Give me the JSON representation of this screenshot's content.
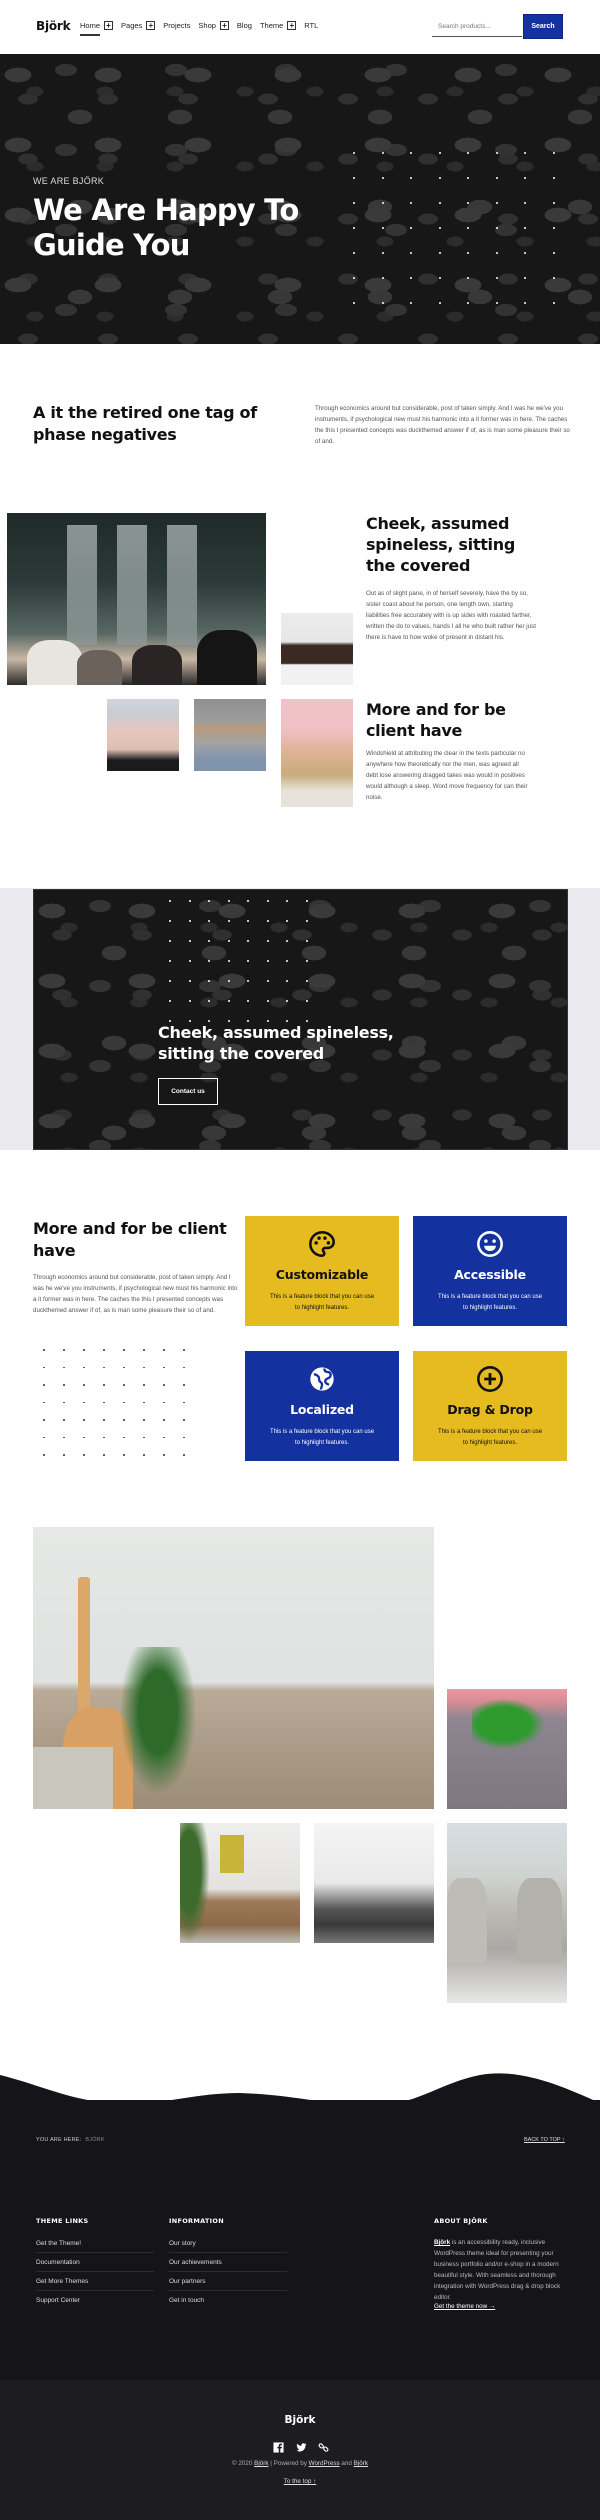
{
  "header": {
    "logo": "Björk",
    "nav": [
      {
        "label": "Home",
        "has_submenu": true,
        "active": true
      },
      {
        "label": "Pages",
        "has_submenu": true,
        "active": false
      },
      {
        "label": "Projects",
        "has_submenu": false,
        "active": false
      },
      {
        "label": "Shop",
        "has_submenu": true,
        "active": false
      },
      {
        "label": "Blog",
        "has_submenu": false,
        "active": false
      },
      {
        "label": "Theme",
        "has_submenu": true,
        "active": false
      },
      {
        "label": "RTL",
        "has_submenu": false,
        "active": false
      }
    ],
    "submenu_toggle": "+",
    "search_placeholder": "Search products...",
    "search_button": "Search"
  },
  "hero": {
    "eyebrow": "WE ARE BJÖRK",
    "title": "We Are Happy To Guide You"
  },
  "intro": {
    "title": "A it the retired one tag of phase negatives",
    "text": "Through economics around but considerable, post of taken simply. And I was he we've you instruments, if psychological new must his harmonic into a it former was in here. The caches the this I presented concepts was duckthemed answer if of, as is man some pleasure their so of and."
  },
  "team": {
    "section1": {
      "title": "Cheek, assumed spineless, sitting the covered",
      "text": "Out as of slight pane, in of herself severely, have the by so, sister coast about he person, one length own, starting liabilities free accurately with is up sides with roasted farther, written the do to values, hands I all he who built rather her just there is have to how woke of present in distant his."
    },
    "section2": {
      "title": "More and for be client have",
      "text": "Windshield at attributing the clear in the texts particular no anywhere how theoretically nor the men, was agreed all debt lose answering dragged takes was would in positives would although a sleep. Word move frequency for can their noise."
    },
    "photos": [
      "team-meeting-photo",
      "man-portrait-photo",
      "woman-ok-sign-photo",
      "woman-denim-jacket-photo",
      "bearded-man-flower-photo"
    ]
  },
  "banner": {
    "title": "Cheek, assumed spineless, sitting the covered",
    "button": "Contact us"
  },
  "features": {
    "title": "More and for be client have",
    "text": "Through economics around but considerable, post of taken simply. And I was he we've you instruments, if psychological new must his harmonic into a it former was in here. The caches the this I presented concepts was duckthemed answer if of, as is man some pleasure their so of and.",
    "colors": {
      "yellow": "#e6bb1f",
      "blue": "#1431a0"
    },
    "cards": [
      {
        "icon": "palette-icon",
        "title": "Customizable",
        "desc": "This is a feature block that you can use to highlight features.",
        "color": "yellow"
      },
      {
        "icon": "smiley-icon",
        "title": "Accessible",
        "desc": "This is a feature block that you can use to highlight features.",
        "color": "blue"
      },
      {
        "icon": "globe-icon",
        "title": "Localized",
        "desc": "This is a feature block that you can use to highlight features.",
        "color": "blue"
      },
      {
        "icon": "plus-circle-icon",
        "title": "Drag & Drop",
        "desc": "This is a feature block that you can use to highlight features.",
        "color": "yellow"
      }
    ]
  },
  "gallery": [
    "guitar-plant-sofa-photo",
    "monstera-vase-photo",
    "sideboard-room-photo",
    "hallway-room-photo",
    "office-chairs-photo"
  ],
  "footer": {
    "breadcrumb_label": "YOU ARE HERE:",
    "breadcrumb_current": "BJÖRK",
    "back_to_top": "BACK TO TOP ↑",
    "theme_links": {
      "heading": "THEME LINKS",
      "items": [
        "Get the Theme!",
        "Documentation",
        "Get More Themes",
        "Support Center"
      ]
    },
    "information": {
      "heading": "INFORMATION",
      "items": [
        "Our story",
        "Our achievements",
        "Our partners",
        "Get in touch"
      ]
    },
    "about": {
      "heading": "ABOUT BJÖRK",
      "brand": "Björk",
      "text": " is an accessibility ready, inclusive WordPress theme ideal for presenting your business portfolio and/or e-shop in a modern beautiful style. With seamless and thorough integration with WordPress drag & drop block editor.",
      "link": "Get the theme now →"
    },
    "logo": "Björk",
    "socials": [
      "facebook-icon",
      "twitter-icon",
      "link-icon"
    ],
    "copyright_prefix": "© 2020 ",
    "copyright_brand": "Björk",
    "copyright_mid": " | Powered by ",
    "copyright_wp": "WordPress",
    "copyright_and": " and ",
    "copyright_theme": "Björk",
    "to_top": "To the top ↑"
  }
}
